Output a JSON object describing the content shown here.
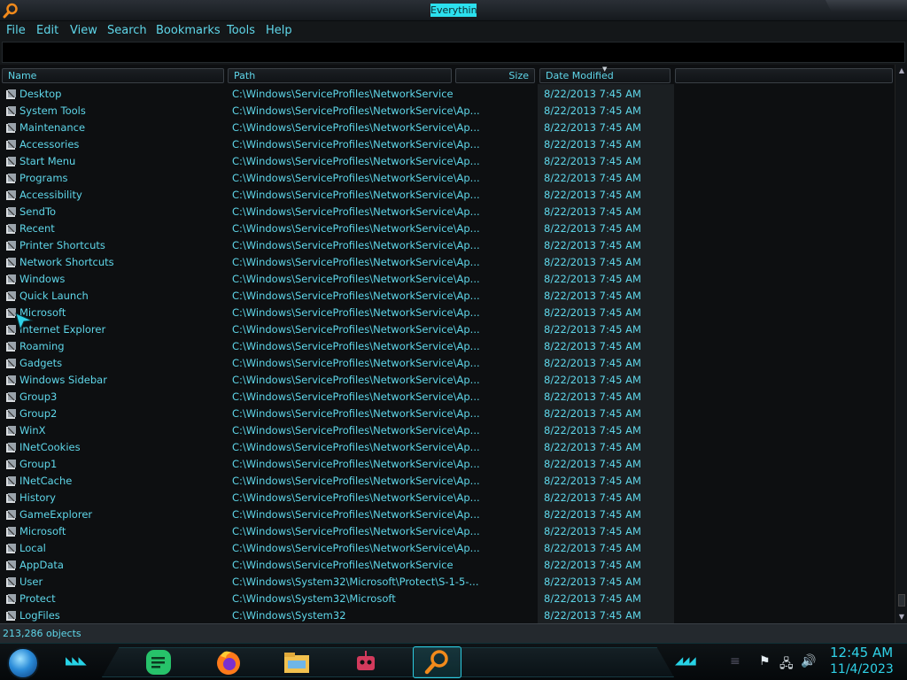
{
  "window": {
    "title": "Everything"
  },
  "menu": [
    "File",
    "Edit",
    "View",
    "Search",
    "Bookmarks",
    "Tools",
    "Help"
  ],
  "search": {
    "value": "",
    "placeholder": ""
  },
  "columns": {
    "name": "Name",
    "path": "Path",
    "size": "Size",
    "date": "Date Modified"
  },
  "rows": [
    {
      "name": "Desktop",
      "path": "C:\\Windows\\ServiceProfiles\\NetworkService",
      "date": "8/22/2013 7:45 AM"
    },
    {
      "name": "System Tools",
      "path": "C:\\Windows\\ServiceProfiles\\NetworkService\\Ap...",
      "date": "8/22/2013 7:45 AM"
    },
    {
      "name": "Maintenance",
      "path": "C:\\Windows\\ServiceProfiles\\NetworkService\\Ap...",
      "date": "8/22/2013 7:45 AM"
    },
    {
      "name": "Accessories",
      "path": "C:\\Windows\\ServiceProfiles\\NetworkService\\Ap...",
      "date": "8/22/2013 7:45 AM"
    },
    {
      "name": "Start Menu",
      "path": "C:\\Windows\\ServiceProfiles\\NetworkService\\Ap...",
      "date": "8/22/2013 7:45 AM"
    },
    {
      "name": "Programs",
      "path": "C:\\Windows\\ServiceProfiles\\NetworkService\\Ap...",
      "date": "8/22/2013 7:45 AM"
    },
    {
      "name": "Accessibility",
      "path": "C:\\Windows\\ServiceProfiles\\NetworkService\\Ap...",
      "date": "8/22/2013 7:45 AM"
    },
    {
      "name": "SendTo",
      "path": "C:\\Windows\\ServiceProfiles\\NetworkService\\Ap...",
      "date": "8/22/2013 7:45 AM"
    },
    {
      "name": "Recent",
      "path": "C:\\Windows\\ServiceProfiles\\NetworkService\\Ap...",
      "date": "8/22/2013 7:45 AM"
    },
    {
      "name": "Printer Shortcuts",
      "path": "C:\\Windows\\ServiceProfiles\\NetworkService\\Ap...",
      "date": "8/22/2013 7:45 AM"
    },
    {
      "name": "Network Shortcuts",
      "path": "C:\\Windows\\ServiceProfiles\\NetworkService\\Ap...",
      "date": "8/22/2013 7:45 AM"
    },
    {
      "name": "Windows",
      "path": "C:\\Windows\\ServiceProfiles\\NetworkService\\Ap...",
      "date": "8/22/2013 7:45 AM"
    },
    {
      "name": "Quick Launch",
      "path": "C:\\Windows\\ServiceProfiles\\NetworkService\\Ap...",
      "date": "8/22/2013 7:45 AM"
    },
    {
      "name": "Microsoft",
      "path": "C:\\Windows\\ServiceProfiles\\NetworkService\\Ap...",
      "date": "8/22/2013 7:45 AM"
    },
    {
      "name": "Internet Explorer",
      "path": "C:\\Windows\\ServiceProfiles\\NetworkService\\Ap...",
      "date": "8/22/2013 7:45 AM"
    },
    {
      "name": "Roaming",
      "path": "C:\\Windows\\ServiceProfiles\\NetworkService\\Ap...",
      "date": "8/22/2013 7:45 AM"
    },
    {
      "name": "Gadgets",
      "path": "C:\\Windows\\ServiceProfiles\\NetworkService\\Ap...",
      "date": "8/22/2013 7:45 AM"
    },
    {
      "name": "Windows Sidebar",
      "path": "C:\\Windows\\ServiceProfiles\\NetworkService\\Ap...",
      "date": "8/22/2013 7:45 AM"
    },
    {
      "name": "Group3",
      "path": "C:\\Windows\\ServiceProfiles\\NetworkService\\Ap...",
      "date": "8/22/2013 7:45 AM"
    },
    {
      "name": "Group2",
      "path": "C:\\Windows\\ServiceProfiles\\NetworkService\\Ap...",
      "date": "8/22/2013 7:45 AM"
    },
    {
      "name": "WinX",
      "path": "C:\\Windows\\ServiceProfiles\\NetworkService\\Ap...",
      "date": "8/22/2013 7:45 AM"
    },
    {
      "name": "INetCookies",
      "path": "C:\\Windows\\ServiceProfiles\\NetworkService\\Ap...",
      "date": "8/22/2013 7:45 AM"
    },
    {
      "name": "Group1",
      "path": "C:\\Windows\\ServiceProfiles\\NetworkService\\Ap...",
      "date": "8/22/2013 7:45 AM"
    },
    {
      "name": "INetCache",
      "path": "C:\\Windows\\ServiceProfiles\\NetworkService\\Ap...",
      "date": "8/22/2013 7:45 AM"
    },
    {
      "name": "History",
      "path": "C:\\Windows\\ServiceProfiles\\NetworkService\\Ap...",
      "date": "8/22/2013 7:45 AM"
    },
    {
      "name": "GameExplorer",
      "path": "C:\\Windows\\ServiceProfiles\\NetworkService\\Ap...",
      "date": "8/22/2013 7:45 AM"
    },
    {
      "name": "Microsoft",
      "path": "C:\\Windows\\ServiceProfiles\\NetworkService\\Ap...",
      "date": "8/22/2013 7:45 AM"
    },
    {
      "name": "Local",
      "path": "C:\\Windows\\ServiceProfiles\\NetworkService\\Ap...",
      "date": "8/22/2013 7:45 AM"
    },
    {
      "name": "AppData",
      "path": "C:\\Windows\\ServiceProfiles\\NetworkService",
      "date": "8/22/2013 7:45 AM"
    },
    {
      "name": "User",
      "path": "C:\\Windows\\System32\\Microsoft\\Protect\\S-1-5-...",
      "date": "8/22/2013 7:45 AM"
    },
    {
      "name": "Protect",
      "path": "C:\\Windows\\System32\\Microsoft",
      "date": "8/22/2013 7:45 AM"
    },
    {
      "name": "LogFiles",
      "path": "C:\\Windows\\System32",
      "date": "8/22/2013 7:45 AM"
    }
  ],
  "status": {
    "text": "213,286 objects"
  },
  "taskbar": {
    "apps": [
      "notes-icon",
      "firefox-icon",
      "file-explorer-icon",
      "robot-icon",
      "everything-search-icon"
    ],
    "tray": [
      "flag-icon",
      "network-icon",
      "volume-icon"
    ],
    "time": "12:45 AM",
    "date": "11/4/2023"
  },
  "colors": {
    "accent": "#5fd7ea",
    "background": "#0d0f11",
    "date_column": "#1b1f22"
  }
}
